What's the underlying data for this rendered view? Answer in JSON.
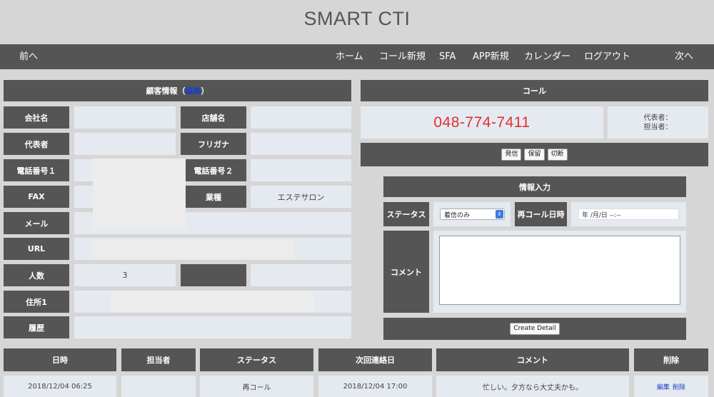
{
  "app": {
    "title": "SMART CTI"
  },
  "nav": {
    "prev": "前へ",
    "home": "ホーム",
    "new_call": "コール新規",
    "sfa": "SFA",
    "app_new": "APP新規",
    "calendar": "カレンダー",
    "logout": "ログアウト",
    "next": "次へ"
  },
  "customer": {
    "section_title": "顧客情報（",
    "edit_link": "編集",
    "section_title_end": "）",
    "labels": {
      "company": "会社名",
      "store": "店舗名",
      "representative": "代表者",
      "furigana": "フリガナ",
      "phone1": "電話番号１",
      "phone2": "電話番号２",
      "fax": "FAX",
      "industry": "業種",
      "email": "メール",
      "url": "URL",
      "headcount": "人数",
      "blank": "",
      "address1": "住所1",
      "history": "履歴"
    },
    "values": {
      "industry": "エステサロン",
      "headcount": "3"
    }
  },
  "call": {
    "section_title": "コール",
    "phone_number": "048-774-7411",
    "representative_label": "代表者：",
    "person_in_charge_label": "担当者：",
    "buttons": {
      "dial": "発信",
      "hold": "保留",
      "hangup": "切断"
    }
  },
  "info_input": {
    "section_title": "情報入力",
    "status_label": "ステータス",
    "status_value": "着信のみ",
    "recall_label": "再コール日時",
    "recall_placeholder": "年 /月/日  --:--",
    "comment_label": "コメント",
    "create_button": "Create Detail"
  },
  "history_table": {
    "headers": [
      "日時",
      "担当者",
      "ステータス",
      "次回連絡日",
      "コメント",
      "削除"
    ],
    "rows": [
      {
        "datetime": "2018/12/04 06:25",
        "staff": "",
        "status": "再コール",
        "next_contact": "2018/12/04 17:00",
        "comment": "忙しい。夕方なら大丈夫かも。",
        "edit": "編集",
        "delete": "削除"
      }
    ]
  },
  "colors": {
    "background": "#d6d6d6",
    "header_dark": "#555555",
    "value_cell": "#e5eaf0",
    "phone_number": "#e03030",
    "link": "#1a3fc7",
    "select_accent": "#3d7be0"
  }
}
